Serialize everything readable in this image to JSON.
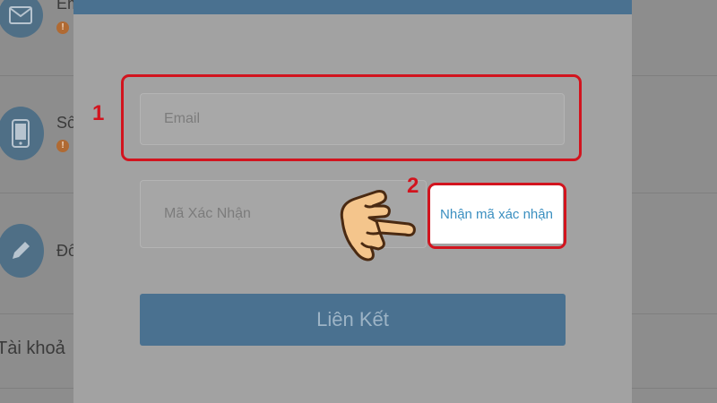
{
  "background": {
    "rows": [
      {
        "label": "Em",
        "icon": "envelope-icon"
      },
      {
        "label": "Số",
        "icon": "phone-icon"
      },
      {
        "label": "Đổ",
        "icon": "pencil-icon"
      }
    ],
    "warning_glyph": "!",
    "bottom_label": "Tài khoả"
  },
  "modal": {
    "email_placeholder": "Email",
    "code_placeholder": "Mã Xác Nhận",
    "get_code_label": "Nhận mã xác nhận",
    "submit_label": "Liên Kết"
  },
  "annotations": {
    "step1": "1",
    "step2": "2"
  },
  "colors": {
    "accent": "#4a7190",
    "link_text": "#3b8fc0",
    "annotation_red": "#d2141e"
  }
}
